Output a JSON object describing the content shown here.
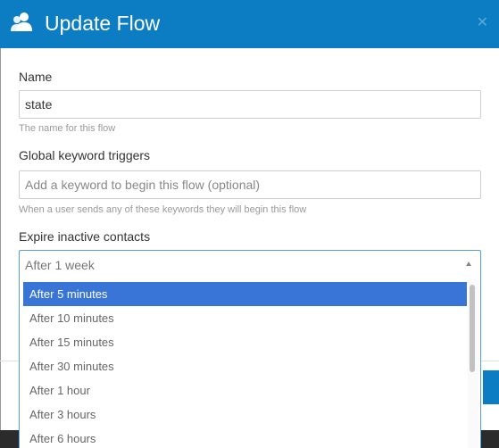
{
  "modal": {
    "title": "Update Flow",
    "close_icon": "close-icon",
    "header_icon": "users-icon"
  },
  "form": {
    "name": {
      "label": "Name",
      "value": "state",
      "help": "The name for this flow"
    },
    "keywords": {
      "label": "Global keyword triggers",
      "placeholder": "Add a keyword to begin this flow (optional)",
      "help": "When a user sends any of these keywords they will begin this flow"
    },
    "expire": {
      "label": "Expire inactive contacts",
      "selected": "After 1 week",
      "options": [
        "After 5 minutes",
        "After 10 minutes",
        "After 15 minutes",
        "After 30 minutes",
        "After 1 hour",
        "After 3 hours",
        "After 6 hours"
      ],
      "highlighted_index": 0
    }
  },
  "colors": {
    "header": "#0c7dc2",
    "highlight": "#3875d7",
    "focus_border": "#5b9dd9"
  }
}
